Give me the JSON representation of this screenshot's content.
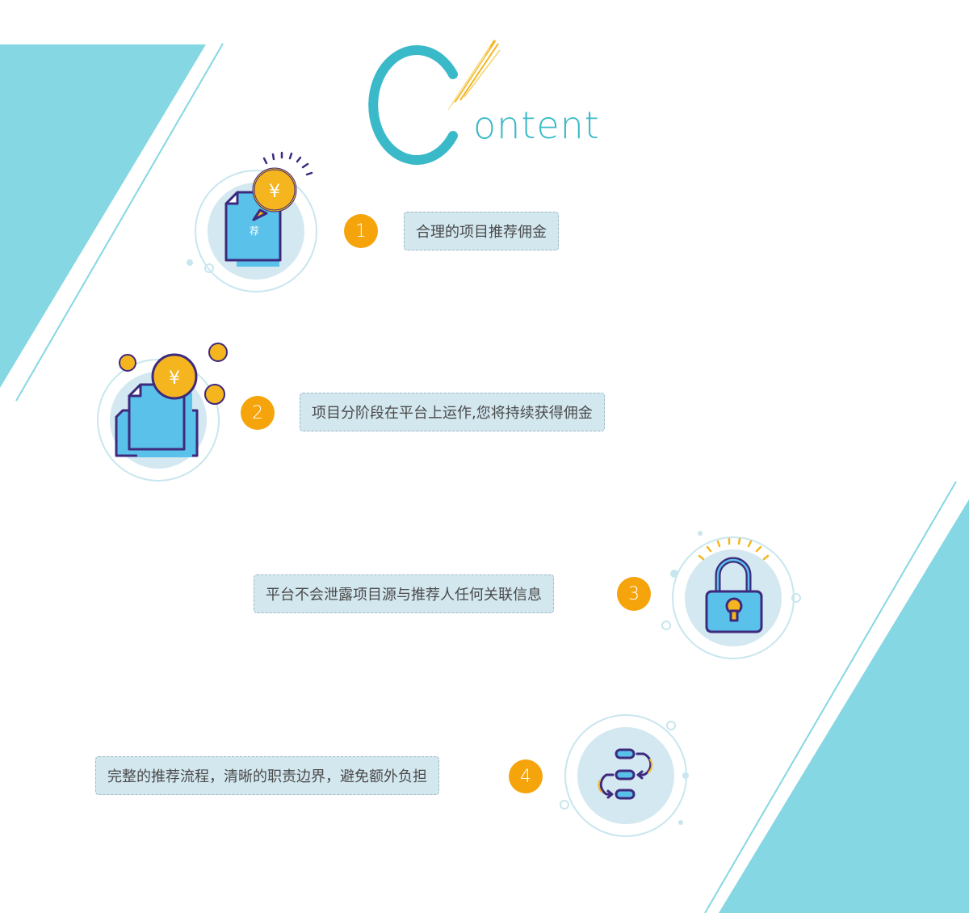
{
  "heading": {
    "initial": "C",
    "rest": "ontent"
  },
  "colors": {
    "accent": "#85d7e3",
    "heading": "#3ab9c9",
    "badge": "#f5a40c",
    "label_bg": "#d3e7ef",
    "icon_outline": "#3d2a7e",
    "icon_fill": "#5ac1ea",
    "coin": "#f4b51f"
  },
  "items": [
    {
      "number": "1",
      "label": "合理的项目推荐佣金",
      "icon": "recommend-document-coin-icon",
      "icon_text": "荐",
      "coin_text": "¥"
    },
    {
      "number": "2",
      "label": "项目分阶段在平台上运作,您将持续获得佣金",
      "icon": "documents-coins-icon",
      "coin_text": "¥"
    },
    {
      "number": "3",
      "label": "平台不会泄露项目源与推荐人任何关联信息",
      "icon": "padlock-icon"
    },
    {
      "number": "4",
      "label": "完整的推荐流程，清晰的职责边界，避免额外负担",
      "icon": "process-flow-icon"
    }
  ]
}
